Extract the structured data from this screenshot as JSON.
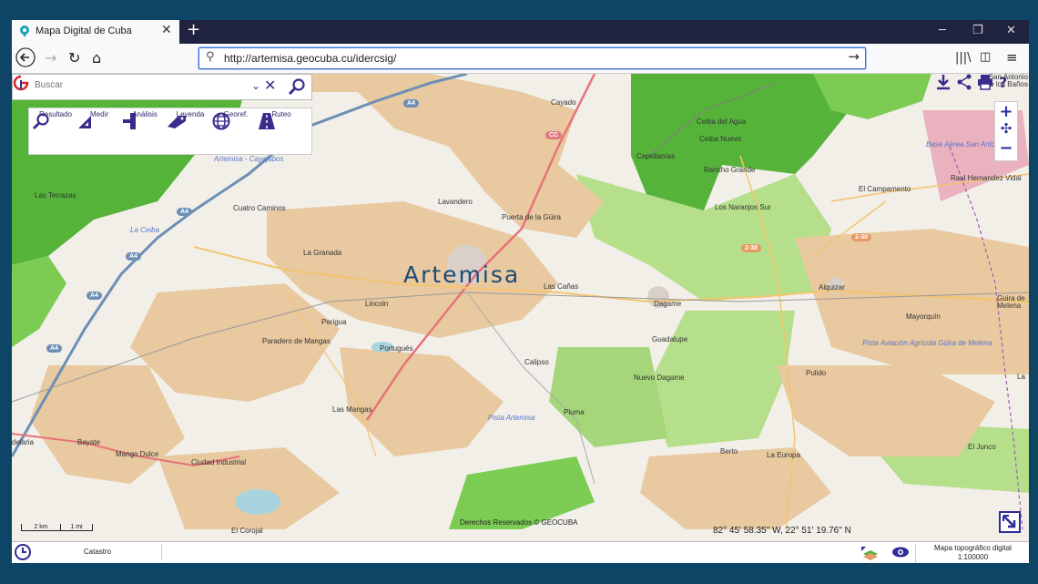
{
  "browser": {
    "tab_title": "Mapa Digital de Cuba",
    "tab_close": "✕",
    "new_tab": "+",
    "url": "http://artemisa.geocuba.cu/idercsig/"
  },
  "search": {
    "placeholder": "Buscar"
  },
  "tools": [
    {
      "label": "Resultado",
      "icon": "magnifier-icon"
    },
    {
      "label": "Medir",
      "icon": "ruler-triangle-icon"
    },
    {
      "label": "Análisis",
      "icon": "analysis-tool-icon"
    },
    {
      "label": "Leyenda",
      "icon": "tag-icon"
    },
    {
      "label": "Georef.",
      "icon": "globe-icon"
    },
    {
      "label": "Ruteo",
      "icon": "road-icon"
    }
  ],
  "map": {
    "main_label": "Artemisa",
    "places": [
      "Cayado",
      "Ceiba del Agua",
      "Ceiba Nuevo",
      "San Antonio de los Baños",
      "Capellanías",
      "Rancho Grande",
      "El Campamento",
      "Raul Hernandez Vidal",
      "Los Naranjos Sur",
      "Lavandero",
      "Puerta de la Güira",
      "Cuatro Caminos",
      "La Granada",
      "Las Terrazas",
      "Artemisa - Cayajabos",
      "La Ceiba",
      "Lincoln",
      "Las Cañas",
      "Dagame",
      "Alquizar",
      "Guira de Melena",
      "Mayorquín",
      "Perigua",
      "Paradero de Mangas",
      "Portugués",
      "Guadalupe",
      "Calipso",
      "Nuevo Dagame",
      "Pulido",
      "La",
      "Las Mangas",
      "Pista Artemisa",
      "Pluma",
      "delaria",
      "Bayate",
      "Mango Dulce",
      "Ciudad Industrial",
      "Berto",
      "La Europa",
      "El Junco",
      "El Corojal",
      "Base Aérea San Antonio",
      "Pista Aviación Agrícola Güira de Melena"
    ],
    "shields": [
      "A4",
      "A4",
      "A4",
      "A4",
      "A4",
      "CC",
      "2-38",
      "2-30"
    ],
    "scale_km": "2 km",
    "scale_mi": "1 mi",
    "credits": "Derechos Reservados © GEOCUBA",
    "coordinates": "82° 45' 58.35\" W, 22° 51' 19.76\" N"
  },
  "status": {
    "layer": "Catastro",
    "basemap_line1": "Mapa topográfico digital",
    "basemap_line2": "1:100000"
  },
  "colors": {
    "accent": "#2c2c9a",
    "urban": "#e8c9a0",
    "forest": "#55b33a",
    "road_primary": "#e8727a",
    "road_secondary": "#f3c56f"
  }
}
